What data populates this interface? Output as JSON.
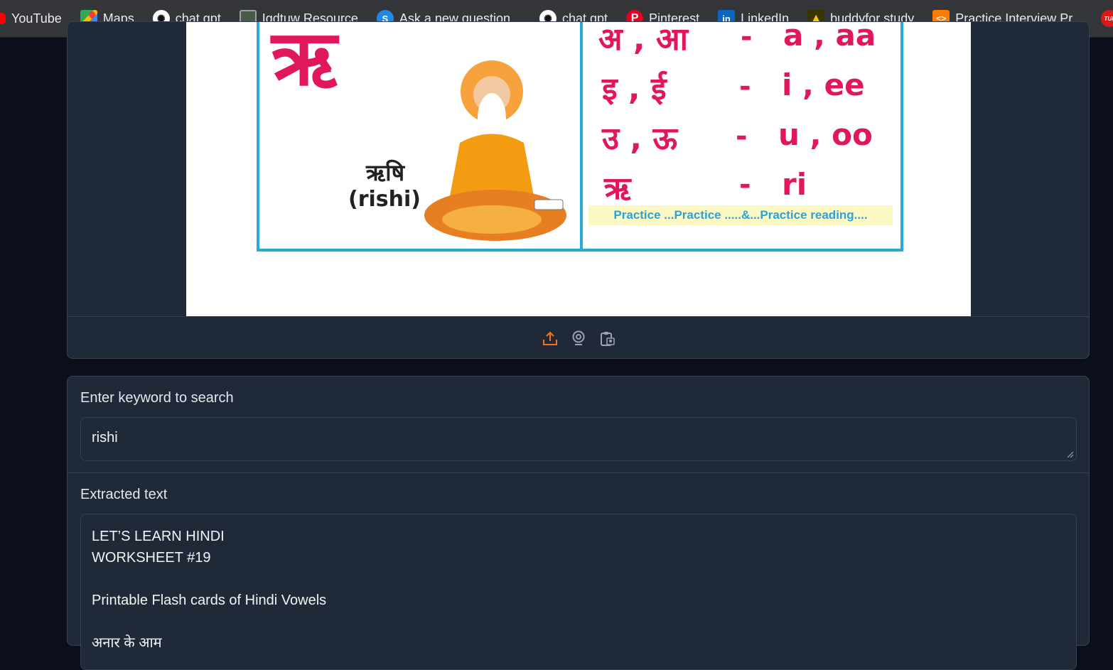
{
  "bookmarks": [
    {
      "label": "YouTube",
      "icon": "youtube-icon"
    },
    {
      "label": "Maps",
      "icon": "google-maps-icon"
    },
    {
      "label": "chat gpt",
      "icon": "chatgpt-icon"
    },
    {
      "label": "Igdtuw Resource",
      "icon": "book-icon"
    },
    {
      "label": "Ask a new question...",
      "icon": "stack-icon"
    },
    {
      "label": "chat gpt",
      "icon": "chatgpt-icon"
    },
    {
      "label": "Pinterest",
      "icon": "pinterest-icon"
    },
    {
      "label": "LinkedIn",
      "icon": "linkedin-icon"
    },
    {
      "label": "buddyfor study",
      "icon": "graduation-cap-icon"
    },
    {
      "label": "Practice Interview Pr...",
      "icon": "practice-icon"
    },
    {
      "label": "TUF",
      "icon": "tuf-icon"
    }
  ],
  "image": {
    "big_letter": "ऋ",
    "word_hindi": "ऋषि",
    "word_roman": "(rishi)",
    "rows": [
      {
        "hindi": "अ , आ",
        "roman": "a , aa"
      },
      {
        "hindi": "इ , ई",
        "roman": "i , ee"
      },
      {
        "hindi": "उ , ऊ",
        "roman": "u , oo"
      },
      {
        "hindi": "ऋ",
        "roman": "ri"
      }
    ],
    "dash": "-",
    "practice_banner": "Practice ...Practice .....&...Practice reading...."
  },
  "toolbar": {
    "upload_icon": "upload-icon",
    "webcam_icon": "webcam-icon",
    "clipboard_icon": "clipboard-icon"
  },
  "search": {
    "label": "Enter keyword to search",
    "value": "rishi"
  },
  "extracted": {
    "label": "Extracted text",
    "lines": [
      "LET’S LEARN HINDI",
      "WORKSHEET #19",
      "",
      "Printable Flash cards of Hindi Vowels",
      "",
      "अनार के आम"
    ]
  },
  "colors": {
    "accent": "#f97316",
    "panel_bg": "#1f2937",
    "page_bg": "#0b0f19",
    "card_pink": "#e0185a",
    "card_border": "#29aad9"
  }
}
